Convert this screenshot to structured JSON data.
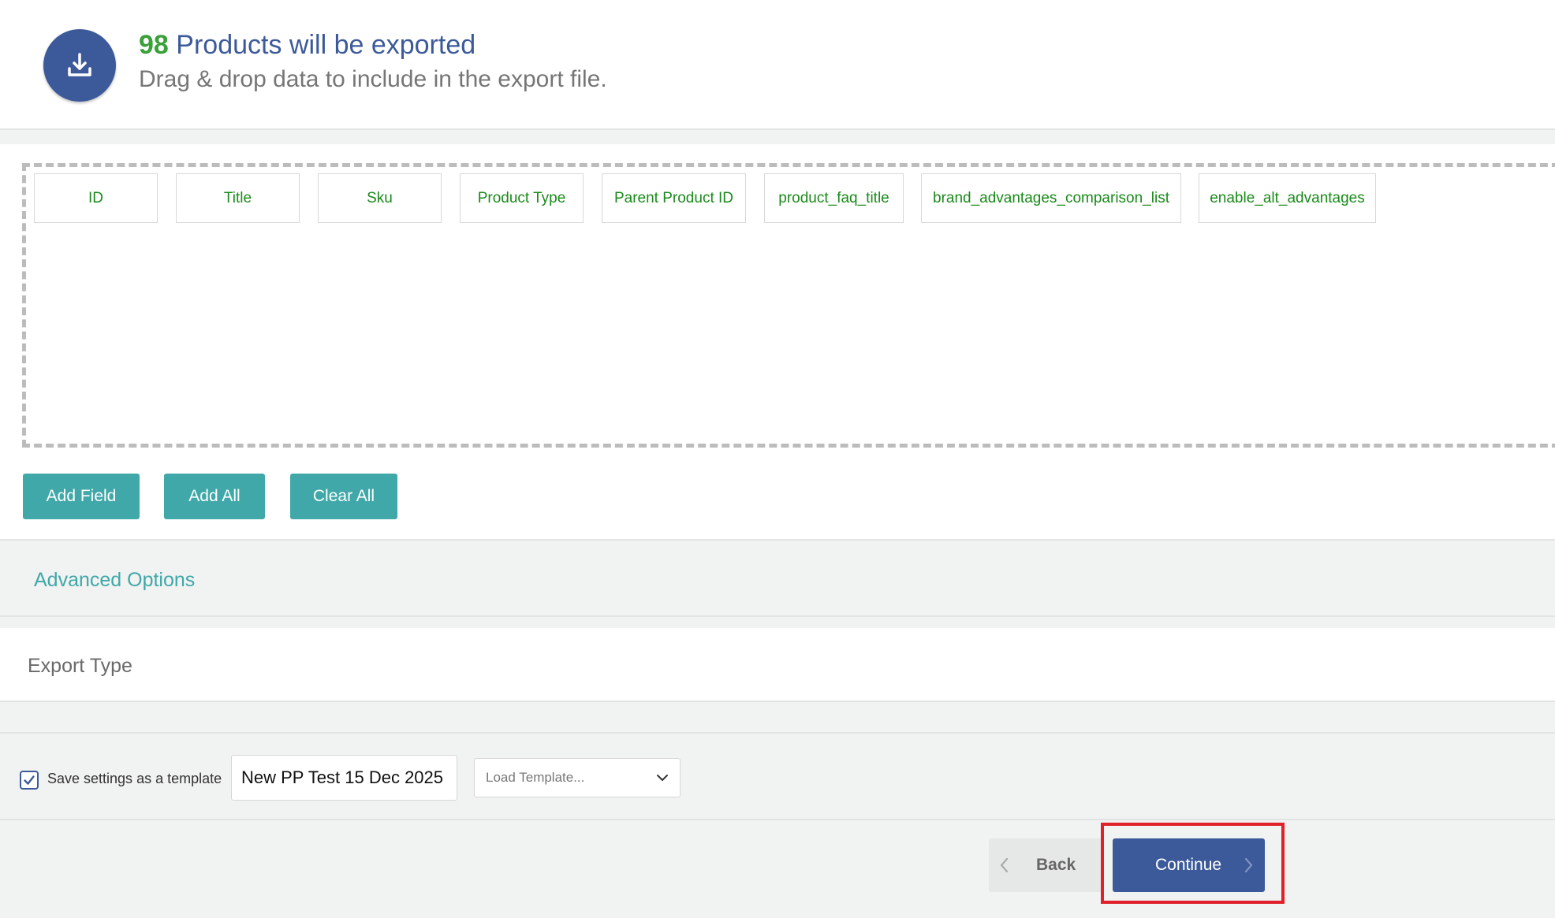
{
  "header": {
    "count": "98",
    "title": "Products will be exported",
    "subtitle": "Drag & drop data to include in the export file.",
    "icon": "download-icon"
  },
  "fields": {
    "chips": [
      {
        "label": "ID"
      },
      {
        "label": "Title"
      },
      {
        "label": "Sku"
      },
      {
        "label": "Product Type"
      },
      {
        "label": "Parent Product ID"
      },
      {
        "label": "product_faq_title"
      },
      {
        "label": "brand_advantages_comparison_list"
      },
      {
        "label": "enable_alt_advantages"
      }
    ],
    "buttons": {
      "add_field": "Add Field",
      "add_all": "Add All",
      "clear_all": "Clear All"
    }
  },
  "advanced": {
    "label": "Advanced Options"
  },
  "export_type": {
    "label": "Export Type"
  },
  "template": {
    "save_checked": true,
    "save_label": "Save settings as a template",
    "name_value": "New PP Test 15 Dec 2025",
    "load_placeholder": "Load Template..."
  },
  "nav": {
    "back_label": "Back",
    "continue_label": "Continue"
  },
  "colors": {
    "accent": "#3c5a9a",
    "teal": "#40a8a8",
    "count_green": "#3aa03a",
    "chip_text": "#1a8a1a",
    "highlight": "#e0202a"
  }
}
